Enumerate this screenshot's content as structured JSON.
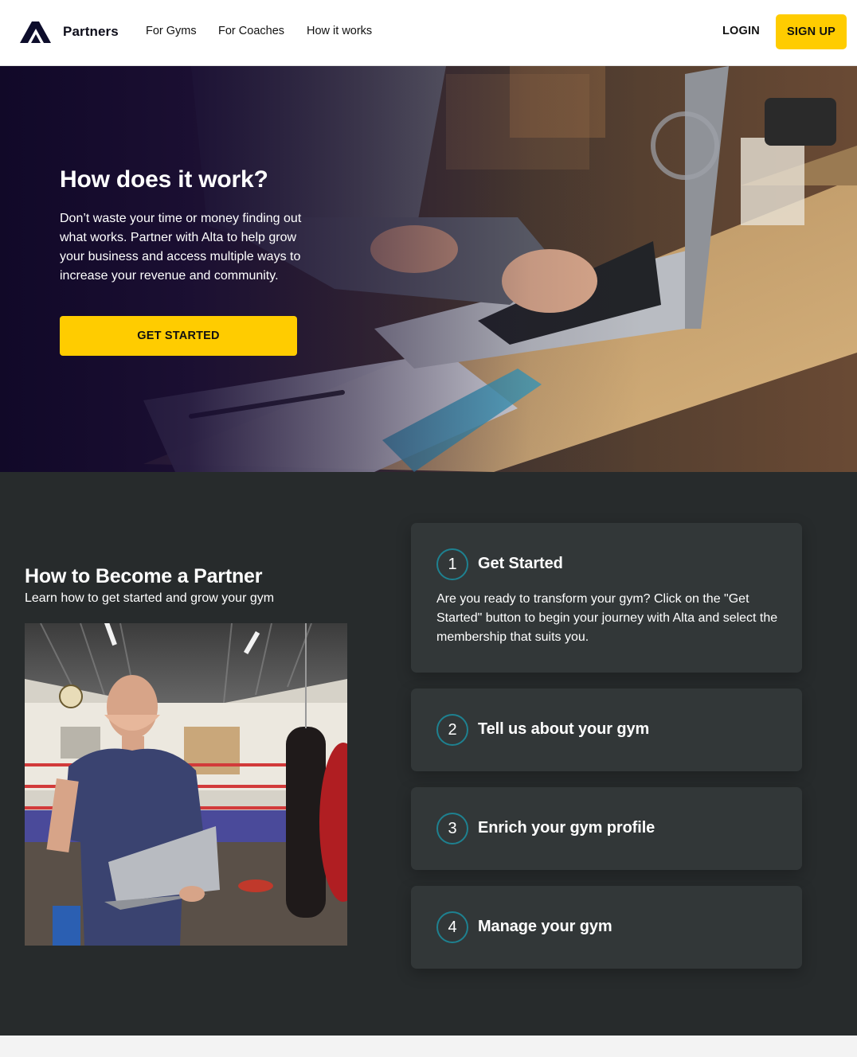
{
  "header": {
    "brand": "Partners",
    "nav": [
      "For Gyms",
      "For Coaches",
      "How it works"
    ],
    "login_label": "LOGIN",
    "signup_label": "SIGN UP"
  },
  "hero": {
    "title": "How does it work?",
    "text": "Don’t waste your time or money finding out what works. Partner with Alta to help grow your business and access multiple ways to increase your revenue and community.",
    "cta_label": "GET STARTED"
  },
  "partner": {
    "title": "How to Become a Partner",
    "subtitle": "Learn how to get started and grow your gym",
    "steps": [
      {
        "number": "1",
        "title": "Get Started",
        "body": "Are you ready to transform your gym? Click on the \"Get Started\" button to begin your journey with Alta and select the membership that suits you."
      },
      {
        "number": "2",
        "title": "Tell us about your gym"
      },
      {
        "number": "3",
        "title": "Enrich your gym profile"
      },
      {
        "number": "4",
        "title": "Manage your gym"
      }
    ]
  },
  "colors": {
    "accent": "#ffcc00",
    "section_bg": "#272b2c",
    "card_bg": "#323738",
    "step_ring": "#1e8190"
  }
}
